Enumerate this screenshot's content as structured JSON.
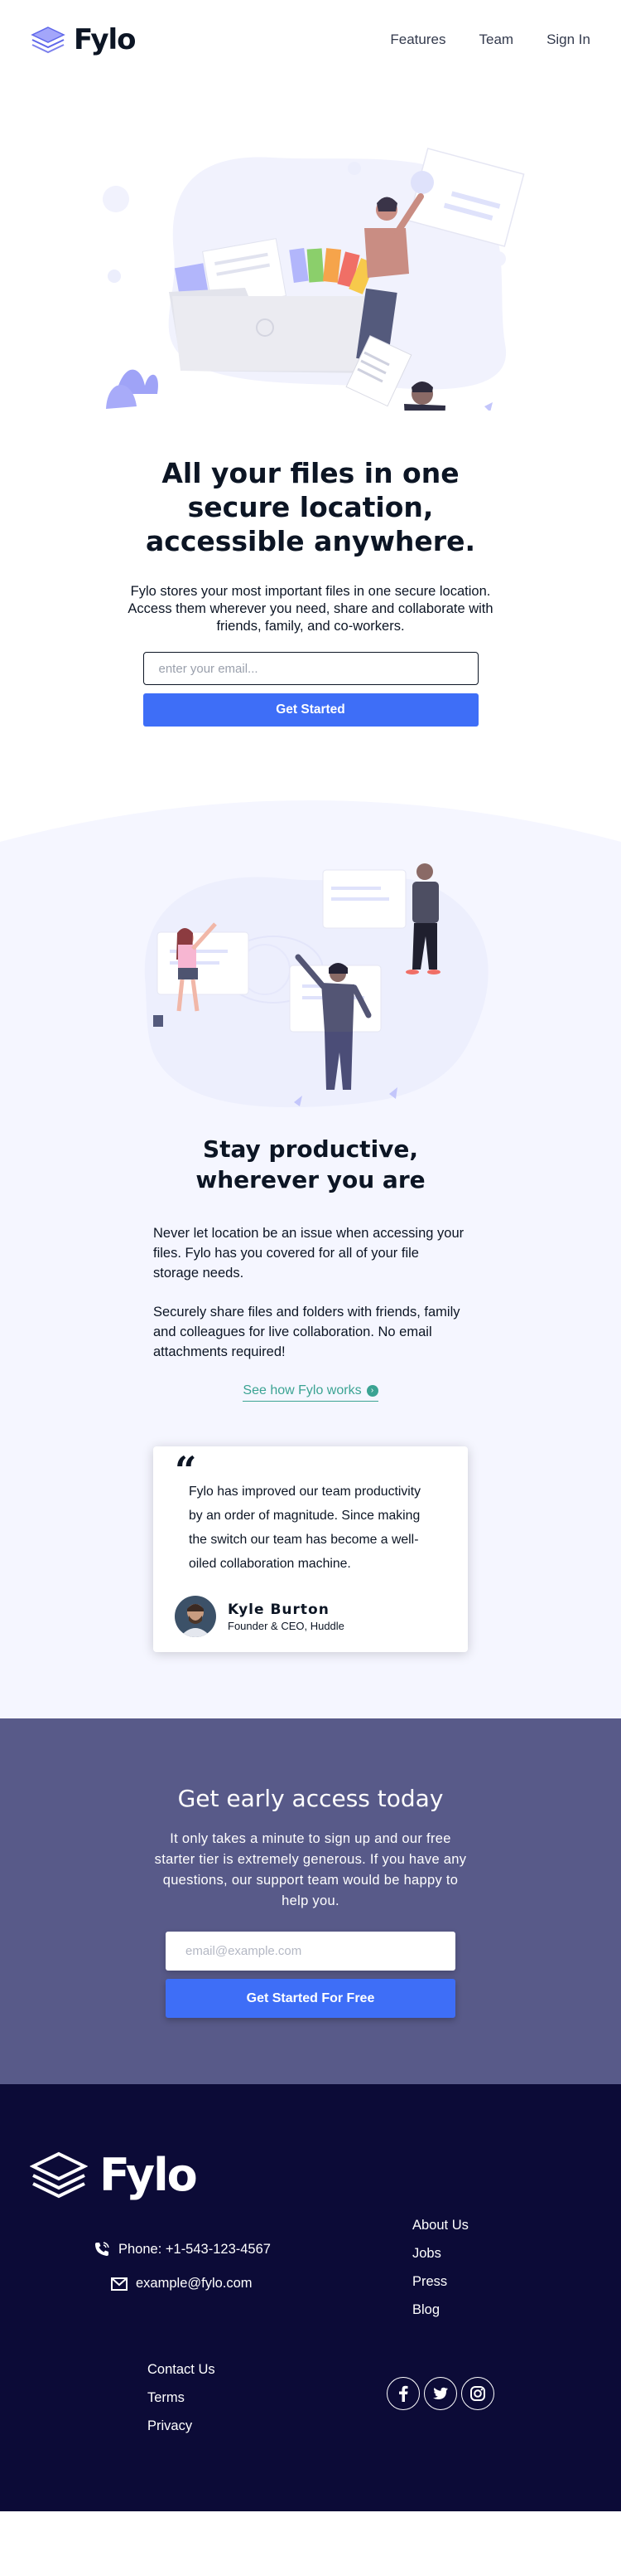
{
  "header": {
    "logo_text": "Fylo",
    "nav": [
      {
        "label": "Features"
      },
      {
        "label": "Team"
      },
      {
        "label": "Sign In"
      }
    ]
  },
  "hero": {
    "title": "All your files in one secure location, accessible anywhere.",
    "text": "Fylo stores your most important files in one secure location. Access them wherever you need, share and collaborate with friends, family, and co-workers.",
    "email_placeholder": "enter your email...",
    "button_label": "Get Started"
  },
  "productive": {
    "title": "Stay productive, wherever you are",
    "paragraphs": [
      "Never let location be an issue when accessing your files. Fylo has you covered for all of your file storage needs.",
      "Securely share files and folders with friends, family and colleagues for live collaboration. No email attachments required!"
    ],
    "link_label": "See how Fylo works",
    "link_icon": "arrow-right-icon"
  },
  "testimonial": {
    "quote_mark": "“",
    "quote": "Fylo has improved our team productivity by an order of magnitude. Since making the switch our team has become a well-oiled collaboration machine.",
    "name": "Kyle Burton",
    "role": "Founder & CEO, Huddle"
  },
  "early_access": {
    "title": "Get early access today",
    "text": "It only takes a minute to sign up and our free starter tier is extremely generous. If you have any questions, our support team would be happy to help you.",
    "email_placeholder": "email@example.com",
    "button_label": "Get Started For Free"
  },
  "footer": {
    "logo_text": "Fylo",
    "phone": "Phone: +1-543-123-4567",
    "email": "example@fylo.com",
    "links_right": [
      "About Us",
      "Jobs",
      "Press",
      "Blog"
    ],
    "links_left": [
      "Contact Us",
      "Terms",
      "Privacy"
    ],
    "socials": [
      "facebook-icon",
      "twitter-icon",
      "instagram-icon"
    ]
  },
  "colors": {
    "brand_blue": "#3e6ef7",
    "teal": "#3ba393",
    "light_bg": "#f5f6ff",
    "purple": "#585a89",
    "footer_navy": "#0c0b37"
  }
}
